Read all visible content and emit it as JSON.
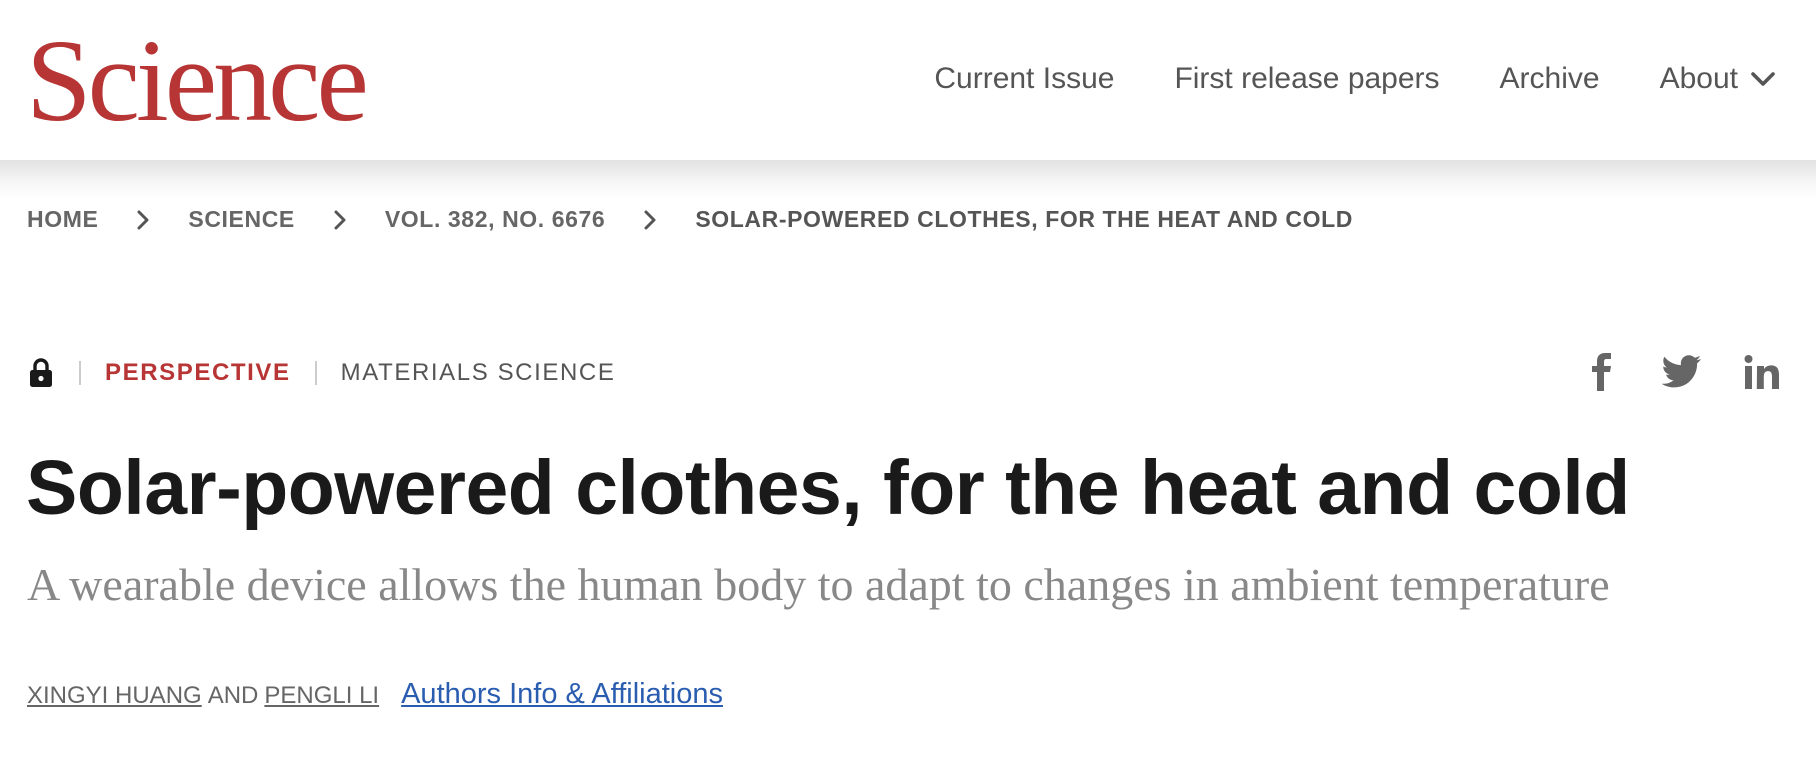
{
  "header": {
    "logo": "Science",
    "nav": [
      {
        "label": "Current Issue"
      },
      {
        "label": "First release papers"
      },
      {
        "label": "Archive"
      },
      {
        "label": "About"
      }
    ]
  },
  "breadcrumb": [
    {
      "label": "HOME"
    },
    {
      "label": "SCIENCE"
    },
    {
      "label": "VOL. 382, NO. 6676"
    },
    {
      "label": "SOLAR-POWERED CLOTHES, FOR THE HEAT AND COLD"
    }
  ],
  "article": {
    "access_icon": "lock-icon",
    "type": "PERSPECTIVE",
    "subject": "MATERIALS SCIENCE",
    "title": "Solar-powered clothes, for the heat and cold",
    "subtitle": "A wearable device allows the human body to adapt to changes in ambient temperature",
    "authors": [
      {
        "name": "XINGYI HUANG"
      },
      {
        "name": "PENGLI LI"
      }
    ],
    "author_conjunction": "AND",
    "affiliations_link": "Authors Info & Affiliations"
  },
  "social": [
    "facebook-icon",
    "twitter-icon",
    "linkedin-icon"
  ],
  "colors": {
    "brand_red": "#b73535",
    "link_blue": "#2a5db0",
    "nav_gray": "#555555",
    "subtitle_gray": "#888888"
  }
}
